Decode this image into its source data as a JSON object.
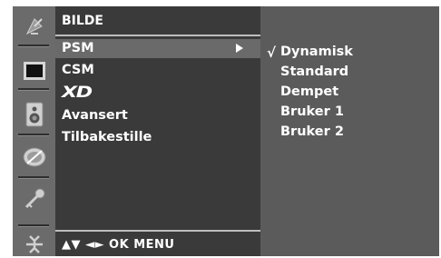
{
  "menu": {
    "title": "BILDE",
    "items": [
      {
        "label": "PSM",
        "selected": true
      },
      {
        "label": "CSM"
      },
      {
        "label": "XD",
        "style": "logo"
      },
      {
        "label": "Avansert"
      },
      {
        "label": "Tilbakestille"
      }
    ],
    "navigation_hint": "▲▼ ◄► OK MENU"
  },
  "submenu": {
    "checkmark": "√",
    "items": [
      {
        "label": "Dynamisk",
        "checked": true
      },
      {
        "label": "Standard"
      },
      {
        "label": "Dempet"
      },
      {
        "label": "Bruker 1"
      },
      {
        "label": "Bruker 2"
      }
    ]
  },
  "sidebar": {
    "icons": [
      "satellite-dish-icon",
      "screen-icon",
      "speaker-icon",
      "clock-icon",
      "key-icon",
      "input-plug-icon"
    ]
  },
  "colors": {
    "osd_bg": "#4a4a4a",
    "icon_column": "#6b6b6b",
    "main_panel": "#3a3a3a",
    "highlight": "#6a6a6a",
    "sub_panel": "#5b5b5b",
    "text": "#ffffff"
  }
}
